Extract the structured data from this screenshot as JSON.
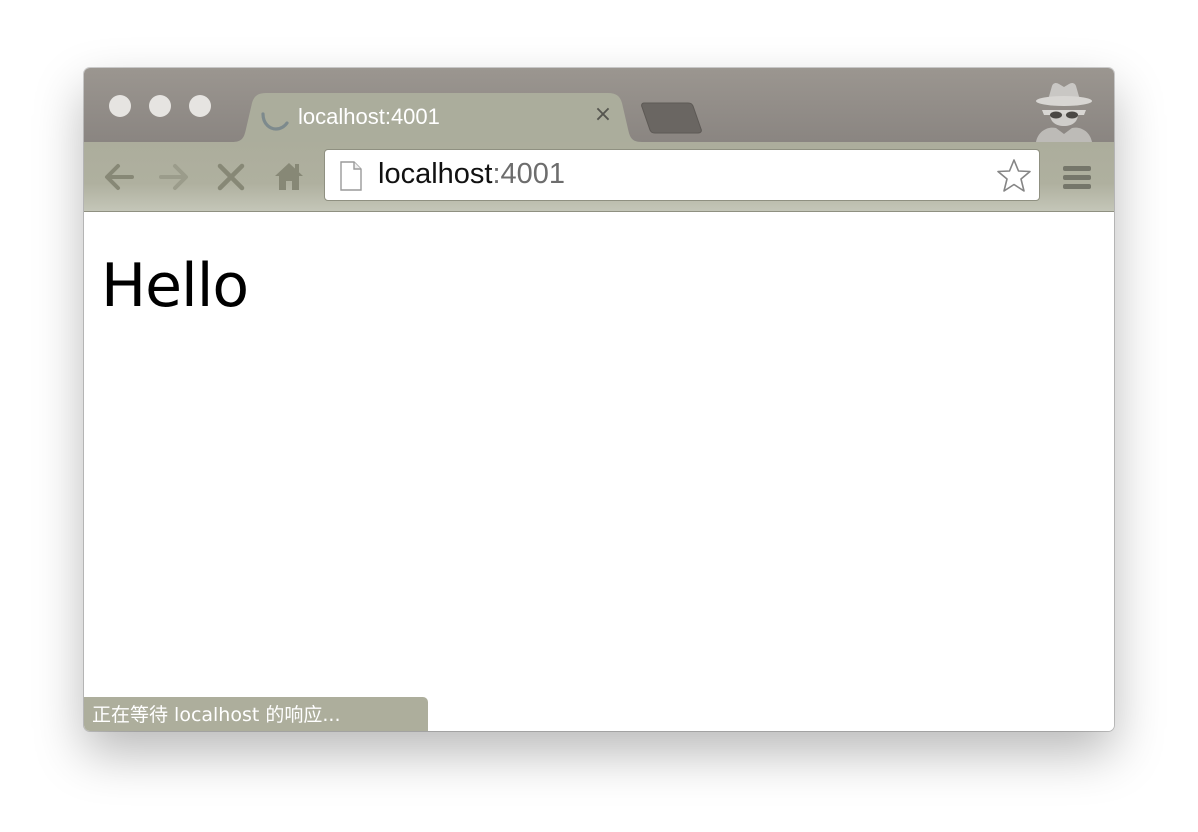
{
  "browser": {
    "tab": {
      "title": "localhost:4001",
      "close_symbol": "×",
      "spinner_icon": "loading-spinner-icon"
    },
    "toolbar": {
      "back_icon": "back-arrow-icon",
      "forward_icon": "forward-arrow-icon",
      "stop_icon": "stop-icon",
      "home_icon": "home-icon",
      "menu_icon": "hamburger-menu-icon"
    },
    "omnibox": {
      "host": "localhost",
      "port": ":4001",
      "page_icon": "page-icon",
      "bookmark_icon": "star-icon"
    },
    "incognito_icon": "incognito-icon",
    "colors": {
      "titlebar": "#8c8783",
      "tab": "#abad9c",
      "toolbar": "#afb09f"
    }
  },
  "page": {
    "heading": "Hello"
  },
  "status": {
    "text": "正在等待 localhost 的响应..."
  }
}
